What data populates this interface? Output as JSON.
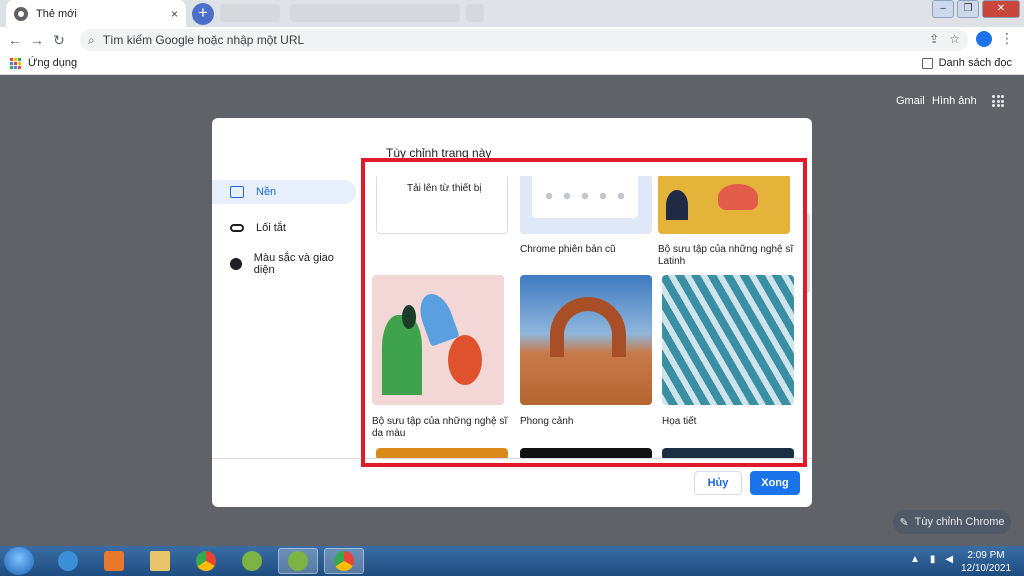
{
  "browser": {
    "tab_title": "Thẻ mới",
    "tab_close": "×",
    "new_tab": "+",
    "omnibox_placeholder": "Tìm kiếm Google hoặc nhập một URL",
    "bookmarks": {
      "apps_label": "Ứng dụng",
      "reading_list": "Danh sách đọc"
    },
    "window_buttons": {
      "minimize": "‒",
      "maximize": "❐",
      "close": "✕"
    }
  },
  "ntp": {
    "links": [
      "Gmail",
      "Hình ảnh"
    ],
    "customize_chrome": "Tùy chỉnh Chrome"
  },
  "dialog": {
    "title": "Tùy chỉnh trang này",
    "sidebar": [
      {
        "label": "Nền",
        "icon": "image-icon",
        "active": true
      },
      {
        "label": "Lối tắt",
        "icon": "link-icon",
        "active": false
      },
      {
        "label": "Màu sắc và giao diện",
        "icon": "palette-icon",
        "active": false
      }
    ],
    "tiles": [
      {
        "label": "Tải lên từ thiết bị"
      },
      {
        "label": "Chrome phiên bản cũ"
      },
      {
        "label": "Bộ sưu tập của những nghệ sĩ Latinh"
      },
      {
        "label": "Bộ sưu tập của những nghệ sĩ da màu"
      },
      {
        "label": "Phong cảnh"
      },
      {
        "label": "Họa tiết"
      }
    ],
    "cancel": "Hủy",
    "done": "Xong"
  },
  "taskbar": {
    "time": "2:09 PM",
    "date": "12/10/2021"
  },
  "colors": {
    "highlight": "#e0192b",
    "accent": "#1a73e8"
  }
}
